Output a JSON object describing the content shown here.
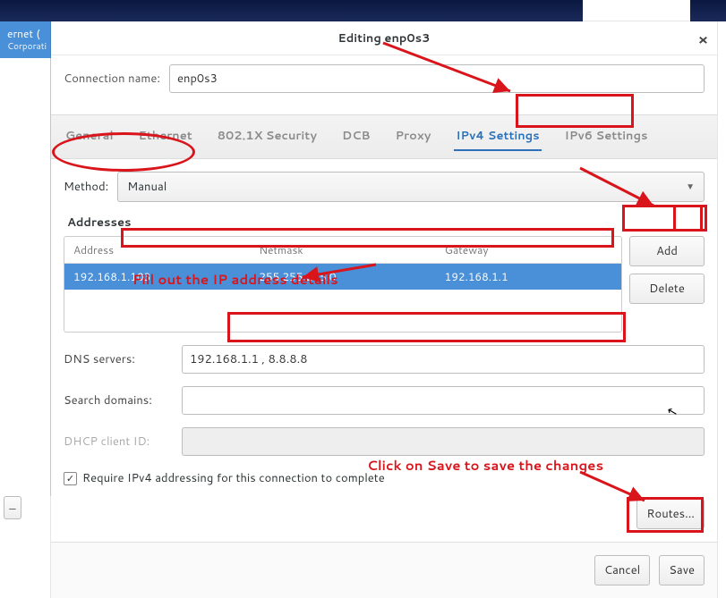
{
  "sidebar": {
    "item_title": "ernet (",
    "item_sub": "Corporati"
  },
  "dialog": {
    "title": "Editing enp0s3",
    "conn_name_label": "Connection name:",
    "conn_name_value": "enp0s3"
  },
  "tabs": [
    "General",
    "Ethernet",
    "802.1X Security",
    "DCB",
    "Proxy",
    "IPv4 Settings",
    "IPv6 Settings"
  ],
  "active_tab_index": 5,
  "ipv4": {
    "method_label": "Method:",
    "method_value": "Manual",
    "addresses_header": "Addresses",
    "columns": [
      "Address",
      "Netmask",
      "Gateway"
    ],
    "rows": [
      {
        "address": "192.168.1.103",
        "netmask": "255.255.255.0",
        "gateway": "192.168.1.1",
        "selected": true
      }
    ],
    "add_label": "Add",
    "delete_label": "Delete",
    "dns_label": "DNS servers:",
    "dns_value": "192.168.1.1 , 8.8.8.8",
    "search_label": "Search domains:",
    "search_value": "",
    "dhcp_label": "DHCP client ID:",
    "dhcp_value": "",
    "require_label": "Require IPv4 addressing for this connection to complete",
    "require_checked": true,
    "routes_label": "Routes…"
  },
  "footer": {
    "cancel": "Cancel",
    "save": "Save"
  },
  "footer_btn_glyph": "–",
  "annotations": {
    "fill_out": "Fill out the IP address details",
    "click_save": "Click on Save to save the changes"
  }
}
